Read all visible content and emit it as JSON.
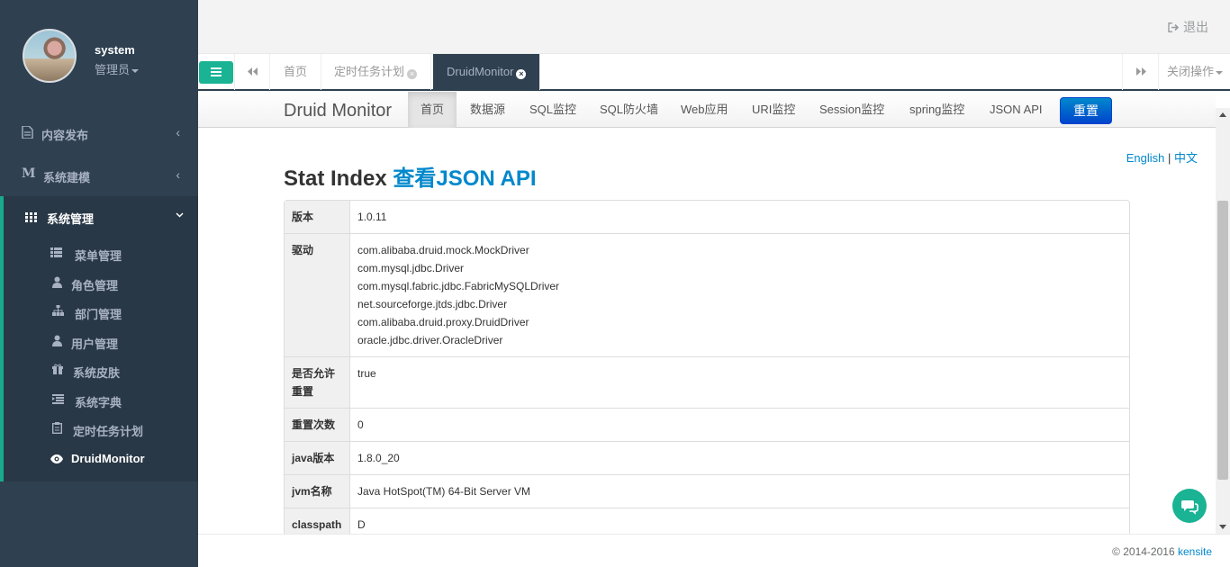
{
  "profile": {
    "name": "system",
    "role": "管理员"
  },
  "sidebar": {
    "groups": [
      {
        "label": "内容发布",
        "arrow": "‹"
      },
      {
        "label": "系统建模",
        "arrow": "‹"
      },
      {
        "label": "系统管理",
        "arrow": "⌄"
      }
    ],
    "sub_items": [
      {
        "label": "菜单管理"
      },
      {
        "label": "角色管理"
      },
      {
        "label": "部门管理"
      },
      {
        "label": "用户管理"
      },
      {
        "label": "系统皮肤"
      },
      {
        "label": "系统字典"
      },
      {
        "label": "定时任务计划"
      },
      {
        "label": "DruidMonitor"
      }
    ]
  },
  "header": {
    "logout": "退出"
  },
  "tabs": {
    "items": [
      {
        "label": "首页"
      },
      {
        "label": "定时任务计划"
      },
      {
        "label": "DruidMonitor"
      }
    ],
    "close_ops": "关闭操作"
  },
  "druid": {
    "brand": "Druid Monitor",
    "nav": [
      "首页",
      "数据源",
      "SQL监控",
      "SQL防火墙",
      "Web应用",
      "URI监控",
      "Session监控",
      "spring监控",
      "JSON API"
    ],
    "reset": "重置",
    "lang_en": "English",
    "lang_sep": "|",
    "lang_zh": "中文",
    "title": "Stat Index",
    "title_link": "查看JSON API",
    "rows": [
      {
        "key": "版本",
        "value": "1.0.11"
      },
      {
        "key": "驱动",
        "values": [
          "com.alibaba.druid.mock.MockDriver",
          "com.mysql.jdbc.Driver",
          "com.mysql.fabric.jdbc.FabricMySQLDriver",
          "net.sourceforge.jtds.jdbc.Driver",
          "com.alibaba.druid.proxy.DruidDriver",
          "oracle.jdbc.driver.OracleDriver"
        ]
      },
      {
        "key": "是否允许重置",
        "value": "true"
      },
      {
        "key": "重置次数",
        "value": "0"
      },
      {
        "key": "java版本",
        "value": "1.8.0_20"
      },
      {
        "key": "jvm名称",
        "value": "Java HotSpot(TM) 64-Bit Server VM"
      },
      {
        "key": "classpath",
        "value": "D"
      }
    ]
  },
  "footer": {
    "copyright": "© 2014-2016",
    "link": "kensite"
  },
  "colors": {
    "sidebar": "#2f4050",
    "accent": "#1ab394",
    "link": "#0088cc"
  }
}
